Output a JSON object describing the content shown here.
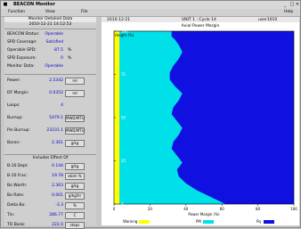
{
  "window": {
    "title": "BEACON Monitor",
    "menu": [
      "Function",
      "View",
      "File",
      "Help"
    ]
  },
  "left_panel": {
    "header": {
      "title": "Monitor Detailed Data",
      "datetime": "2010-12-21 14:12:53"
    },
    "status_rows": [
      {
        "label": "BEACON Status:",
        "value": "Operable"
      },
      {
        "label": "SPD Coverage:",
        "value": "Satisfied"
      },
      {
        "label": "Operable SPD:",
        "value": "87.5",
        "unit": "%"
      },
      {
        "label": "SPD Exposure:",
        "value": "0",
        "unit": "%"
      },
      {
        "label": "Monitor Data:",
        "value": "Operable"
      }
    ],
    "param_rows": [
      {
        "label": "Power:",
        "value": "2.5342",
        "unit": "rel"
      },
      {
        "label": "DF Margin:",
        "value": "0.0352",
        "unit": "rel"
      },
      {
        "label": "Loops:",
        "value": "4"
      },
      {
        "label": "Burnup:",
        "value": "5479.1",
        "unit": "MWD/MTU"
      },
      {
        "label": "Pin Burnup:",
        "value": "23231.1",
        "unit": "MWD/MTU"
      },
      {
        "label": "Boron:",
        "value": "2.361",
        "unit": "g/kg"
      }
    ],
    "section_title": "Includes Effect Of",
    "effect_rows": [
      {
        "label": "B-10 Depl:",
        "value": "0.144",
        "unit": "g/kg"
      },
      {
        "label": "B-10 Frac:",
        "value": "19.78",
        "unit": "atom %"
      },
      {
        "label": "Bo Worth:",
        "value": "2.363",
        "unit": "g/kg"
      },
      {
        "label": "Bo Rate:",
        "value": "0.001",
        "unit": "g/kg/hr"
      },
      {
        "label": "Delta Bo:",
        "value": "-3.3",
        "unit": "%"
      },
      {
        "label": "Tin:",
        "value": "286.77",
        "unit": "C"
      },
      {
        "label": "TO Bank:",
        "value": "222.0",
        "unit": "steps"
      }
    ]
  },
  "right_panel": {
    "header": {
      "date": "2010-12-21",
      "cycle": "UNIT 1 : Cycle 14",
      "user": "user1010"
    },
    "chart_title": "Axial Power Margin"
  },
  "chart_data": {
    "type": "area",
    "title": "Axial Power Margin",
    "xlabel": "Power Margin (%)",
    "ylabel": "Height (%)",
    "xlim": [
      0,
      100
    ],
    "ylim": [
      0,
      100
    ],
    "x_ticks": [
      "0",
      "20",
      "40",
      "60",
      "80",
      "100"
    ],
    "y_ticks": [
      "0",
      "25",
      "50",
      "75",
      "100"
    ],
    "legend": [
      {
        "name": "Warning",
        "color": "#ffff00"
      },
      {
        "name": "PM",
        "color": "#00e0e8"
      },
      {
        "name": "Pq",
        "color": "#1010e0"
      }
    ],
    "warning_band": [
      0,
      3
    ],
    "boundary": [
      {
        "h": 100,
        "x": 32
      },
      {
        "h": 97,
        "x": 32
      },
      {
        "h": 95,
        "x": 34
      },
      {
        "h": 92,
        "x": 36
      },
      {
        "h": 88,
        "x": 38
      },
      {
        "h": 84,
        "x": 36
      },
      {
        "h": 80,
        "x": 33
      },
      {
        "h": 76,
        "x": 31
      },
      {
        "h": 72,
        "x": 31
      },
      {
        "h": 68,
        "x": 34
      },
      {
        "h": 64,
        "x": 38
      },
      {
        "h": 60,
        "x": 36
      },
      {
        "h": 56,
        "x": 33
      },
      {
        "h": 52,
        "x": 32
      },
      {
        "h": 48,
        "x": 35
      },
      {
        "h": 44,
        "x": 38
      },
      {
        "h": 40,
        "x": 36
      },
      {
        "h": 36,
        "x": 33
      },
      {
        "h": 32,
        "x": 32
      },
      {
        "h": 28,
        "x": 35
      },
      {
        "h": 24,
        "x": 38
      },
      {
        "h": 20,
        "x": 35
      },
      {
        "h": 16,
        "x": 36
      },
      {
        "h": 12,
        "x": 40
      },
      {
        "h": 8,
        "x": 46
      },
      {
        "h": 4,
        "x": 54
      },
      {
        "h": 0,
        "x": 62
      }
    ]
  }
}
